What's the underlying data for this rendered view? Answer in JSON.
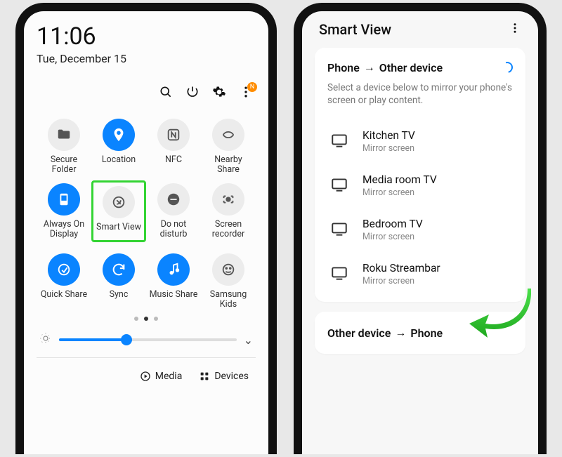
{
  "left": {
    "time": "11:06",
    "date": "Tue, December 15",
    "notification_badge": "N",
    "toggles": [
      {
        "id": "secure-folder",
        "label": "Secure Folder",
        "on": false,
        "icon": "folder"
      },
      {
        "id": "location",
        "label": "Location",
        "on": true,
        "icon": "pin"
      },
      {
        "id": "nfc",
        "label": "NFC",
        "on": false,
        "icon": "nfc"
      },
      {
        "id": "nearby-share",
        "label": "Nearby Share",
        "on": false,
        "icon": "nearby"
      },
      {
        "id": "always-on",
        "label": "Always On Display",
        "on": true,
        "icon": "aod"
      },
      {
        "id": "smart-view",
        "label": "Smart View",
        "on": false,
        "icon": "cast",
        "highlighted": true
      },
      {
        "id": "dnd",
        "label": "Do not disturb",
        "on": false,
        "icon": "dnd"
      },
      {
        "id": "screen-recorder",
        "label": "Screen recorder",
        "on": false,
        "icon": "rec"
      },
      {
        "id": "quick-share",
        "label": "Quick Share",
        "on": true,
        "icon": "qshare"
      },
      {
        "id": "sync",
        "label": "Sync",
        "on": true,
        "icon": "sync"
      },
      {
        "id": "music-share",
        "label": "Music Share",
        "on": true,
        "icon": "mshare"
      },
      {
        "id": "samsung-kids",
        "label": "Samsung Kids",
        "on": false,
        "icon": "kids"
      }
    ],
    "page_dots": {
      "count": 3,
      "active": 1
    },
    "brightness_percent": 38,
    "actions": {
      "media": "Media",
      "devices": "Devices"
    }
  },
  "right": {
    "header": "Smart View",
    "section_title_a": "Phone",
    "section_title_b": "Other device",
    "subtitle": "Select a device below to mirror your phone's screen or play content.",
    "devices": [
      {
        "name": "Kitchen TV",
        "mode": "Mirror screen"
      },
      {
        "name": "Media room TV",
        "mode": "Mirror screen"
      },
      {
        "name": "Bedroom TV",
        "mode": "Mirror screen"
      },
      {
        "name": "Roku Streambar",
        "mode": "Mirror screen"
      }
    ],
    "bottom_title_a": "Other device",
    "bottom_title_b": "Phone"
  }
}
